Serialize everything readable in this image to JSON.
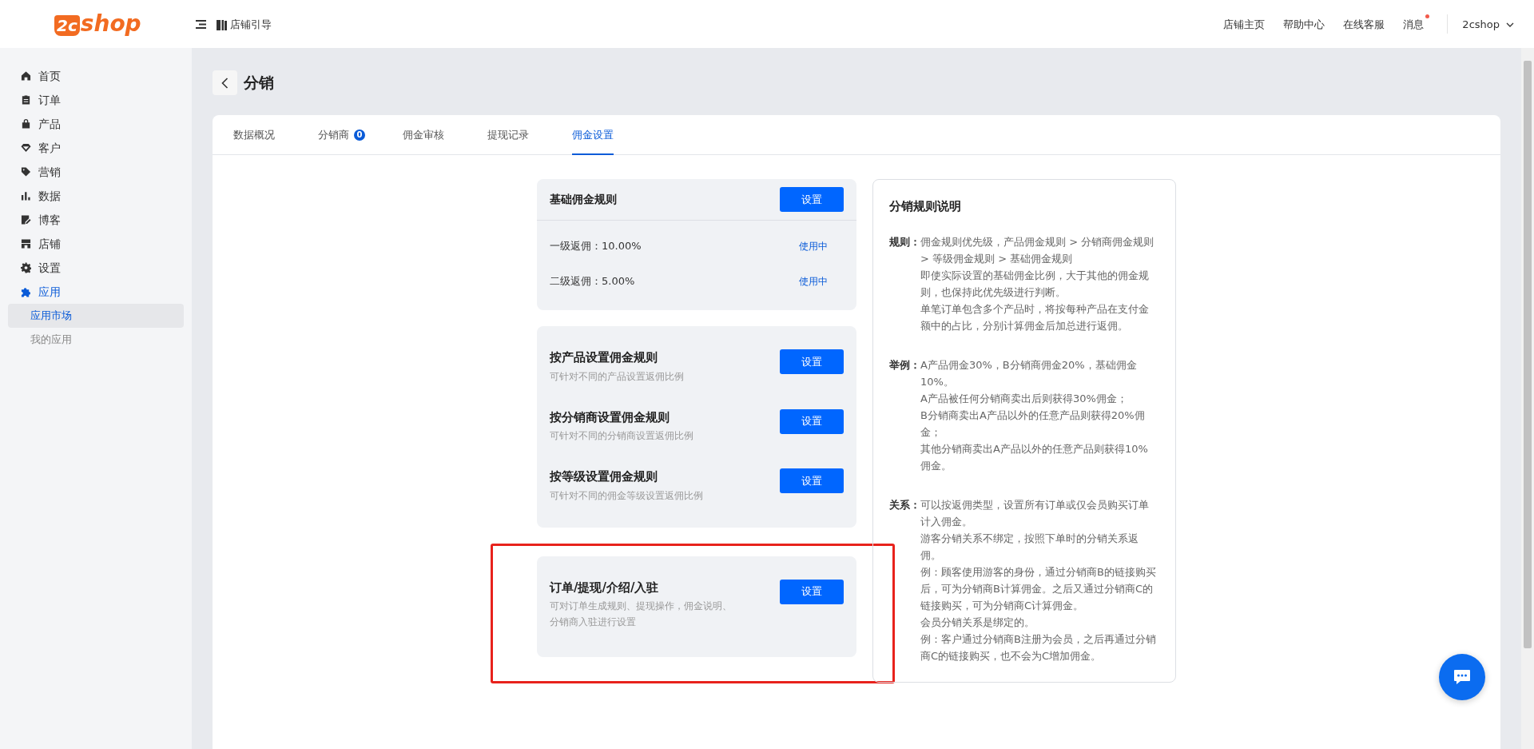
{
  "header": {
    "logo_badge": "2c",
    "logo_text": "shop",
    "guide_link": "店铺引导",
    "links": [
      {
        "label": "店铺主页",
        "unread": false
      },
      {
        "label": "帮助中心",
        "unread": false
      },
      {
        "label": "在线客服",
        "unread": false
      },
      {
        "label": "消息",
        "unread": true
      }
    ],
    "account": "2cshop"
  },
  "sidebar": {
    "items": [
      {
        "label": "首页",
        "selected": false
      },
      {
        "label": "订单",
        "selected": false
      },
      {
        "label": "产品",
        "selected": false
      },
      {
        "label": "客户",
        "selected": false
      },
      {
        "label": "营销",
        "selected": false
      },
      {
        "label": "数据",
        "selected": false
      },
      {
        "label": "博客",
        "selected": false
      },
      {
        "label": "店铺",
        "selected": false
      },
      {
        "label": "设置",
        "selected": false
      },
      {
        "label": "应用",
        "selected": true,
        "children": [
          {
            "label": "应用市场",
            "selected": true
          },
          {
            "label": "我的应用",
            "selected": false
          }
        ]
      }
    ]
  },
  "page": {
    "title": "分销"
  },
  "tabs": [
    {
      "label": "数据概况",
      "selected": false
    },
    {
      "label": "分销商",
      "badge": "0",
      "selected": false
    },
    {
      "label": "佣金审核",
      "selected": false
    },
    {
      "label": "提现记录",
      "selected": false
    },
    {
      "label": "佣金设置",
      "selected": true
    }
  ],
  "base_rule": {
    "title": "基础佣金规则",
    "button": "设置",
    "rows": [
      {
        "label": "一级返佣：10.00%",
        "status": "使用中"
      },
      {
        "label": "二级返佣：5.00%",
        "status": "使用中"
      }
    ]
  },
  "rule_groups": [
    {
      "highlighted": false,
      "items": [
        {
          "title": "按产品设置佣金规则",
          "description": "可针对不同的产品设置返佣比例",
          "button": "设置"
        },
        {
          "title": "按分销商设置佣金规则",
          "description": "可针对不同的分销商设置返佣比例",
          "button": "设置"
        },
        {
          "title": "按等级设置佣金规则",
          "description": "可针对不同的佣金等级设置返佣比例",
          "button": "设置"
        }
      ]
    },
    {
      "highlighted": true,
      "items": [
        {
          "title": "订单/提现/介绍/入驻",
          "description": "可对订单生成规则、提现操作，佣金说明、分销商入驻进行设置",
          "button": "设置"
        }
      ]
    }
  ],
  "explanation": {
    "title": "分销规则说明",
    "sections": [
      {
        "label": "规则：",
        "lines": [
          "佣金规则优先级，产品佣金规则 > 分销商佣金规则 > 等级佣金规则 > 基础佣金规则",
          "即使实际设置的基础佣金比例，大于其他的佣金规则，也保持此优先级进行判断。",
          "单笔订单包含多个产品时，将按每种产品在支付金额中的占比，分别计算佣金后加总进行返佣。"
        ]
      },
      {
        "label": "举例：",
        "lines": [
          "A产品佣金30%，B分销商佣金20%，基础佣金10%。",
          "A产品被任何分销商卖出后则获得30%佣金；",
          "B分销商卖出A产品以外的任意产品则获得20%佣金；",
          "其他分销商卖出A产品以外的任意产品则获得10%佣金。"
        ]
      },
      {
        "label": "关系：",
        "lines": [
          "可以按返佣类型，设置所有订单或仅会员购买订单计入佣金。",
          "游客分销关系不绑定，按照下单时的分销关系返佣。",
          "例：顾客使用游客的身份，通过分销商B的链接购买后，可为分销商B计算佣金。之后又通过分销商C的链接购买，可为分销商C计算佣金。",
          "会员分销关系是绑定的。",
          "例：客户通过分销商B注册为会员，之后再通过分销商C的链接购买，也不会为C增加佣金。"
        ]
      }
    ]
  }
}
